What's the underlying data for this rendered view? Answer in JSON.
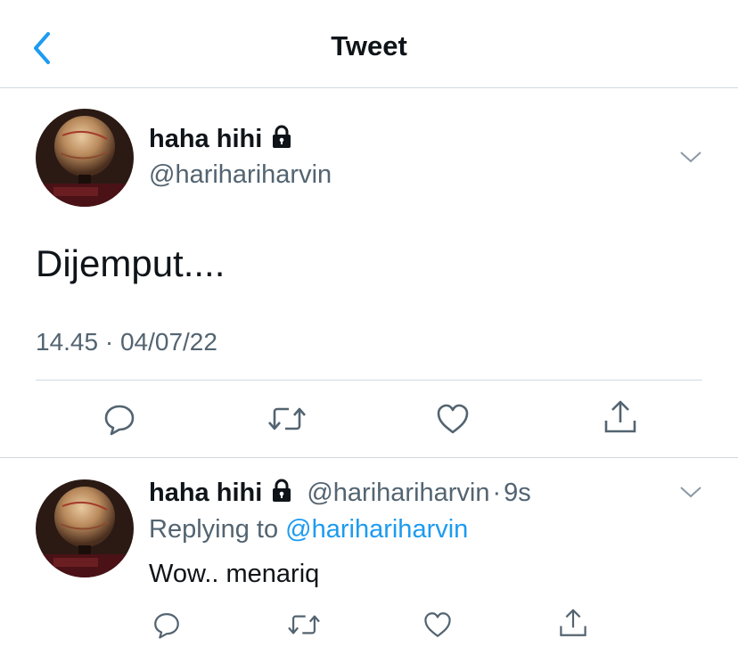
{
  "header": {
    "title": "Tweet",
    "back_icon": "chevron-left-icon",
    "accent": "#1d9bf0"
  },
  "main_tweet": {
    "author_name": "haha hihi",
    "author_handle": "@harihariharvin",
    "text": "Dijemput....",
    "timestamp": "14.45 · 04/07/22",
    "actions": [
      "reply-icon",
      "retweet-icon",
      "like-icon",
      "share-icon"
    ]
  },
  "reply": {
    "author_name": "haha hihi",
    "author_handle": "@harihariharvin",
    "separator": "·",
    "time_ago": "9s",
    "replying_prefix": "Replying to",
    "replying_handle": "@harihariharvin",
    "text": "Wow.. menariq"
  }
}
